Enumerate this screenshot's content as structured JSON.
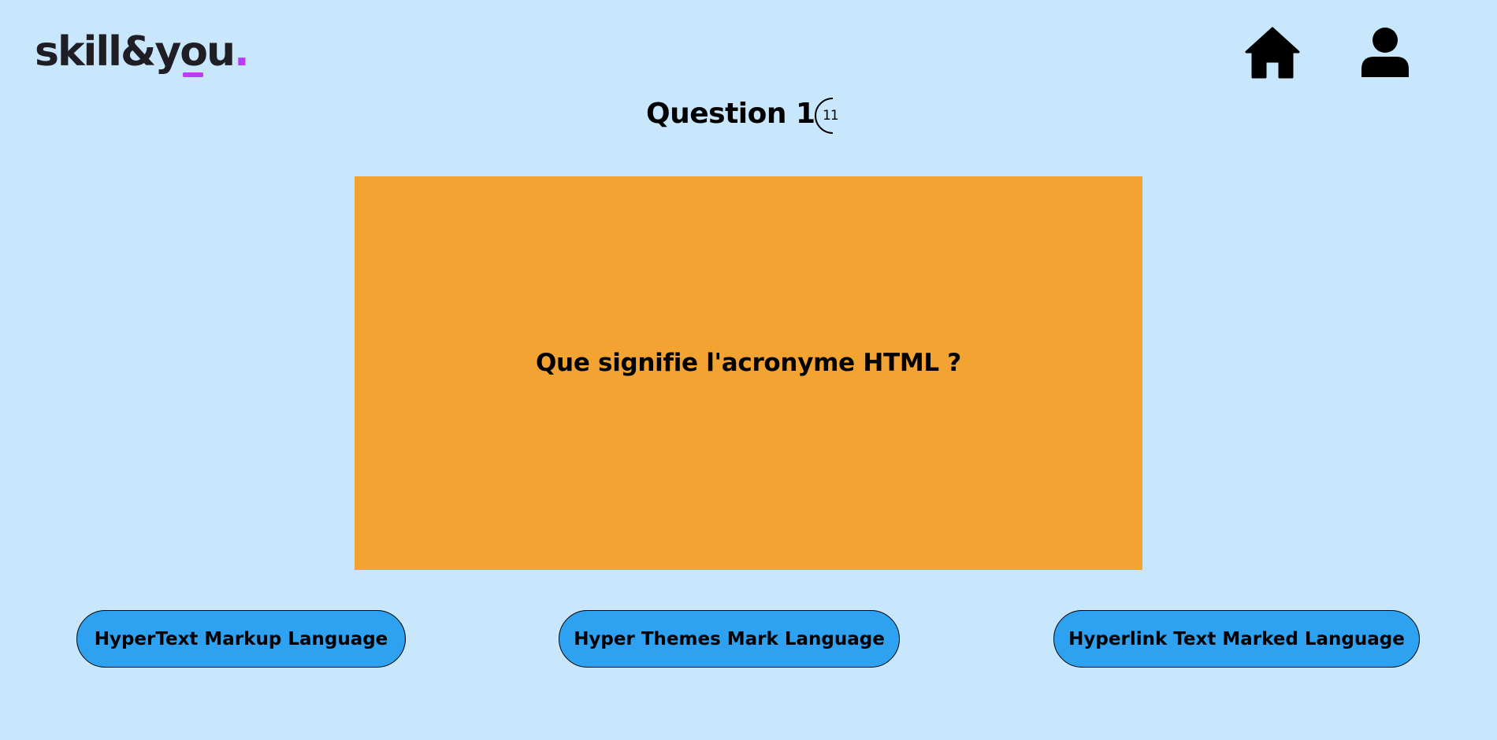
{
  "header": {
    "logo": {
      "part1": "skill&y",
      "part2": "o",
      "part3": "u",
      "part4": "."
    },
    "icons": {
      "home": "home-icon",
      "user": "user-icon"
    }
  },
  "quiz": {
    "question_label": "Question 1",
    "timer_value": "11",
    "question_text": "Que signifie l'acronyme HTML ?",
    "answers": [
      "HyperText Markup Language",
      "Hyper Themes Mark Language",
      "Hyperlink Text Marked Language"
    ]
  },
  "colors": {
    "background": "#c8e6fc",
    "card": "#f3a331",
    "answer_button": "#2ea1f0",
    "logo_accent": "#b93cf6",
    "logo_text": "#1e1e24"
  }
}
